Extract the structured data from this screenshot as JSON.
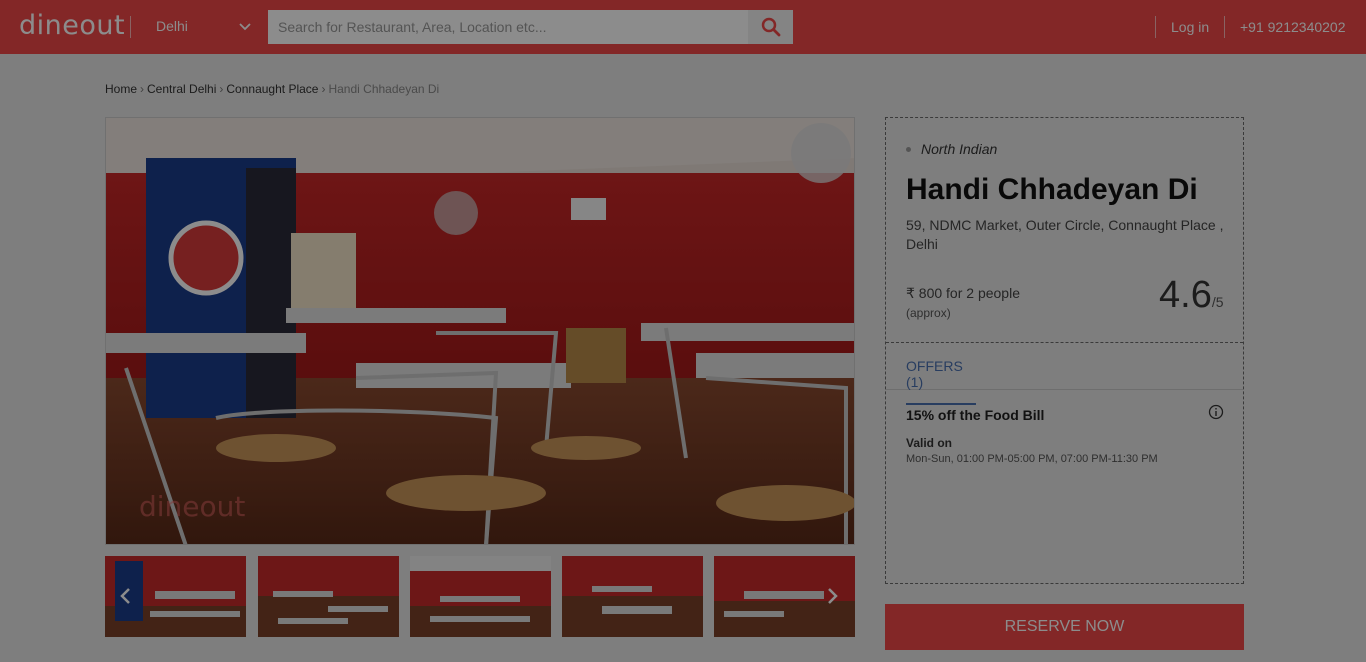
{
  "header": {
    "logo": "dineout",
    "city": "Delhi",
    "search_placeholder": "Search for Restaurant, Area, Location etc...",
    "login_label": "Log in",
    "phone": "+91 9212340202"
  },
  "breadcrumb": [
    "Home",
    "Central Delhi",
    "Connaught Place",
    "Handi Chhadeyan Di"
  ],
  "gallery": {
    "watermark": "dineout"
  },
  "restaurant": {
    "cuisine": "North Indian",
    "name": "Handi Chhadeyan Di",
    "address": "59, NDMC Market, Outer Circle, Connaught Place , Delhi",
    "cost": "₹ 800 for 2 people",
    "cost_note": "(approx)",
    "rating": "4.6",
    "rating_scale": "/5"
  },
  "offers": {
    "tab_label": "OFFERS (1)",
    "title": "15% off the Food Bill",
    "valid_label": "Valid on",
    "valid_times": "Mon-Sun, 01:00 PM-05:00 PM, 07:00 PM-11:30 PM"
  },
  "cta": {
    "reserve_label": "RESERVE NOW"
  },
  "colors": {
    "brand": "#ef4747",
    "link": "#4a70b0",
    "overlay": "rgba(0,0,0,0.45)"
  }
}
